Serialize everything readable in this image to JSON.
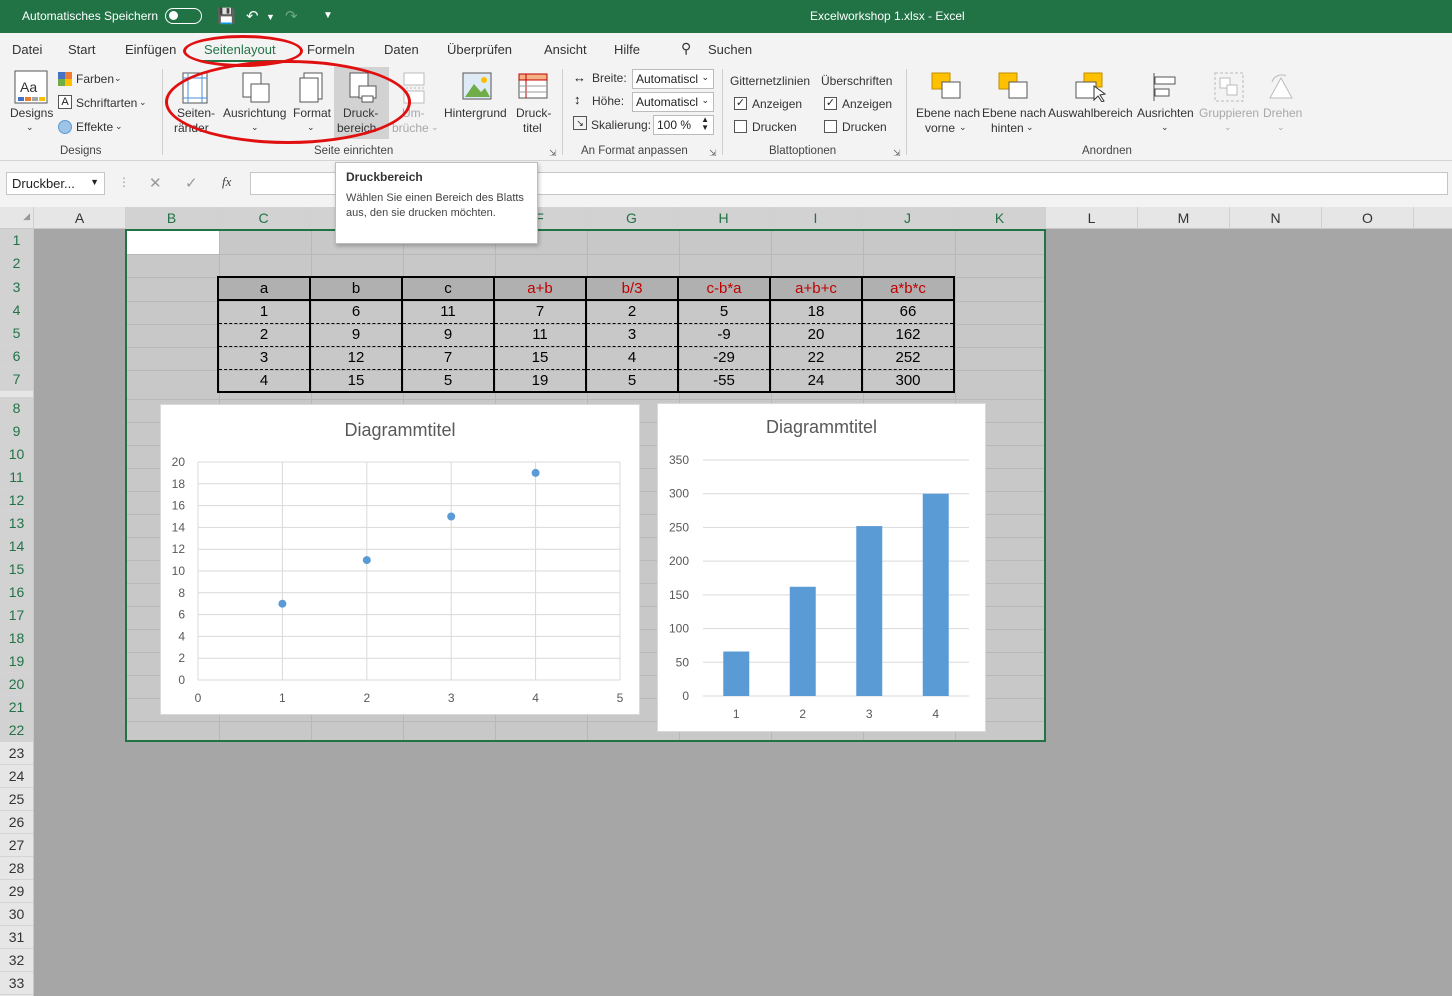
{
  "titlebar": {
    "autosave_label": "Automatisches Speichern",
    "doc_title": "Excelworkshop 1.xlsx  -  Excel"
  },
  "menu": {
    "items": [
      "Datei",
      "Start",
      "Einfügen",
      "Seitenlayout",
      "Formeln",
      "Daten",
      "Überprüfen",
      "Ansicht",
      "Hilfe"
    ],
    "search": "Suchen",
    "active": "Seitenlayout"
  },
  "ribbon": {
    "designs": {
      "label": "Designs",
      "designs_btn": "Designs",
      "farben": "Farben",
      "schriftarten": "Schriftarten",
      "effekte": "Effekte"
    },
    "seite": {
      "label": "Seite einrichten",
      "seitenraender": [
        "Seiten-",
        "ränder"
      ],
      "ausrichtung": "Ausrichtung",
      "format": "Format",
      "druckbereich": [
        "Druck-",
        "bereich"
      ],
      "umbrueche": [
        "Um-",
        "brüche"
      ],
      "hintergrund": "Hintergrund",
      "drucktitel": [
        "Druck-",
        "titel"
      ]
    },
    "anformat": {
      "label": "An Format anpassen",
      "breite_label": "Breite:",
      "breite_value": "Automatiscl",
      "hoehe_label": "Höhe:",
      "hoehe_value": "Automatiscl",
      "skalierung_label": "Skalierung:",
      "skalierung_value": "100 %"
    },
    "blattoptionen": {
      "label": "Blattoptionen",
      "gitternetz": "Gitternetzlinien",
      "ueberschriften": "Überschriften",
      "anzeigen": "Anzeigen",
      "drucken": "Drucken"
    },
    "anordnen": {
      "label": "Anordnen",
      "ebene_vorne": [
        "Ebene nach",
        "vorne"
      ],
      "ebene_hinten": [
        "Ebene nach",
        "hinten"
      ],
      "auswahlbereich": "Auswahlbereich",
      "ausrichten": "Ausrichten",
      "gruppieren": "Gruppieren",
      "drehen": "Drehen"
    }
  },
  "formulabar": {
    "namebox": "Druckber...",
    "fx": "fx"
  },
  "tooltip": {
    "title": "Druckbereich",
    "body": "Wählen Sie einen Bereich des Blatts aus, den sie drucken möchten."
  },
  "sheet": {
    "columns": [
      "A",
      "B",
      "C",
      "D",
      "E",
      "F",
      "G",
      "H",
      "I",
      "J",
      "K",
      "L",
      "M",
      "N",
      "O"
    ],
    "rows": [
      "1",
      "2",
      "3",
      "4",
      "5",
      "6",
      "7",
      "8",
      "9",
      "10",
      "11",
      "12",
      "13",
      "14",
      "15",
      "16",
      "17",
      "18",
      "19",
      "20",
      "21",
      "22",
      "23",
      "24",
      "25",
      "26",
      "27",
      "28",
      "29",
      "30",
      "31",
      "32",
      "33"
    ],
    "table": {
      "headers": [
        "a",
        "b",
        "c",
        "a+b",
        "b/3",
        "c-b*a",
        "a+b+c",
        "a*b*c"
      ],
      "rows": [
        [
          "1",
          "6",
          "11",
          "7",
          "2",
          "5",
          "18",
          "66"
        ],
        [
          "2",
          "9",
          "9",
          "11",
          "3",
          "-9",
          "20",
          "162"
        ],
        [
          "3",
          "12",
          "7",
          "15",
          "4",
          "-29",
          "22",
          "252"
        ],
        [
          "4",
          "15",
          "5",
          "19",
          "5",
          "-55",
          "24",
          "300"
        ]
      ]
    }
  },
  "chart_data": [
    {
      "type": "scatter",
      "title": "Diagrammtitel",
      "x": [
        1,
        2,
        3,
        4
      ],
      "y": [
        7,
        11,
        15,
        19
      ],
      "xlim": [
        0,
        5
      ],
      "ylim": [
        0,
        20
      ],
      "xticks": [
        "0",
        "1",
        "2",
        "3",
        "4",
        "5"
      ],
      "yticks": [
        "0",
        "2",
        "4",
        "6",
        "8",
        "10",
        "12",
        "14",
        "16",
        "18",
        "20"
      ],
      "grid": true,
      "color": "#5b9bd5"
    },
    {
      "type": "bar",
      "title": "Diagrammtitel",
      "categories": [
        "1",
        "2",
        "3",
        "4"
      ],
      "values": [
        66,
        162,
        252,
        300
      ],
      "ylim": [
        0,
        350
      ],
      "yticks": [
        "0",
        "50",
        "100",
        "150",
        "200",
        "250",
        "300",
        "350"
      ],
      "grid": true,
      "color": "#5b9bd5"
    }
  ]
}
